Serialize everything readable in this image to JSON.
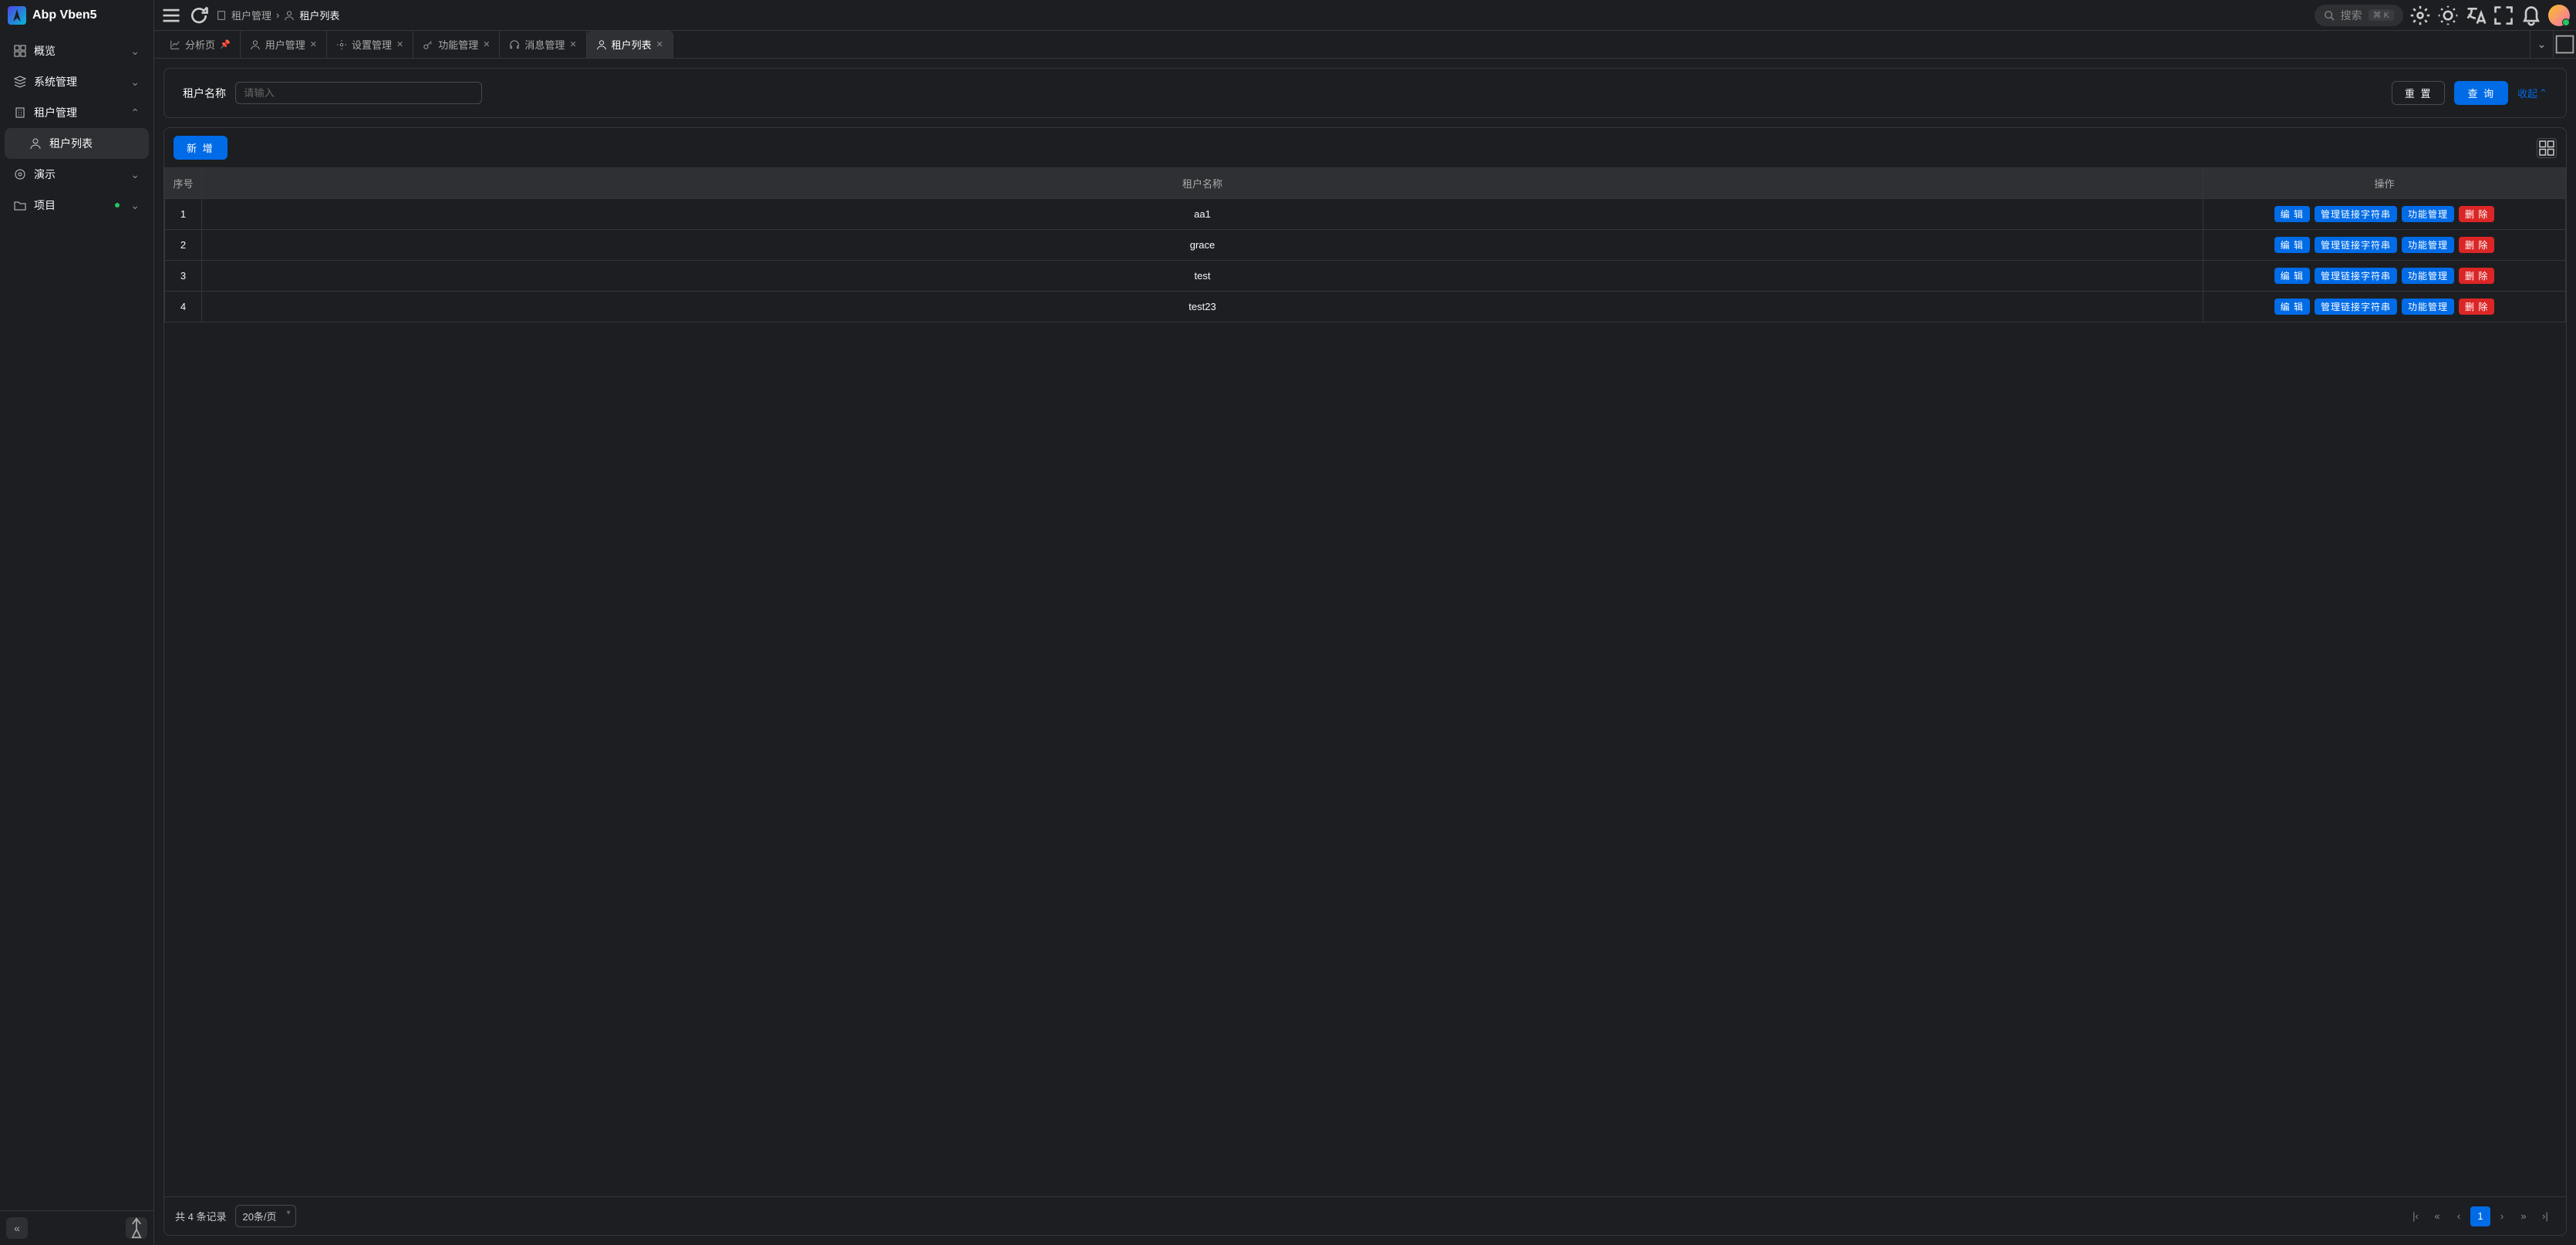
{
  "logo": {
    "text": "Abp Vben5"
  },
  "sidebar": {
    "items": [
      {
        "label": "概览",
        "expanded": false
      },
      {
        "label": "系统管理",
        "expanded": false
      },
      {
        "label": "租户管理",
        "expanded": true
      },
      {
        "label": "租户列表",
        "sub": true,
        "active": true
      },
      {
        "label": "演示",
        "expanded": false
      },
      {
        "label": "项目",
        "dot": true
      }
    ]
  },
  "breadcrumb": {
    "parent": "租户管理",
    "current": "租户列表"
  },
  "search": {
    "placeholder": "搜索",
    "kbd": "⌘ K"
  },
  "tabs": [
    {
      "label": "分析页",
      "pinned": true
    },
    {
      "label": "用户管理"
    },
    {
      "label": "设置管理"
    },
    {
      "label": "功能管理"
    },
    {
      "label": "消息管理"
    },
    {
      "label": "租户列表",
      "active": true
    }
  ],
  "filter": {
    "name_label": "租户名称",
    "name_placeholder": "请输入",
    "reset": "重 置",
    "query": "查 询",
    "collapse": "收起"
  },
  "toolbar": {
    "add": "新 增"
  },
  "table": {
    "columns": {
      "idx": "序号",
      "name": "租户名称",
      "ops": "操作"
    },
    "rows": [
      {
        "idx": 1,
        "name": "aa1"
      },
      {
        "idx": 2,
        "name": "grace"
      },
      {
        "idx": 3,
        "name": "test"
      },
      {
        "idx": 4,
        "name": "test23"
      }
    ],
    "actions": {
      "edit": "编 辑",
      "conn": "管理链接字符串",
      "feat": "功能管理",
      "del": "删 除"
    }
  },
  "pagination": {
    "total_text": "共 4 条记录",
    "page_size": "20条/页",
    "current": "1"
  }
}
